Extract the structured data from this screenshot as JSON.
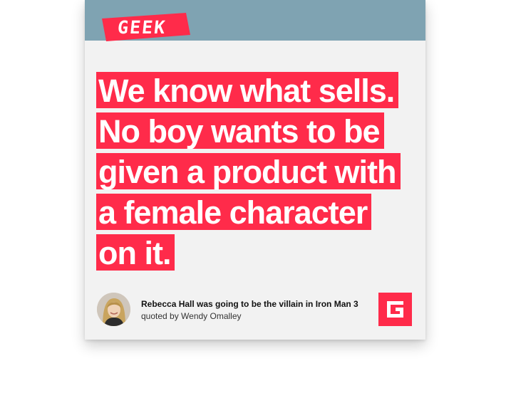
{
  "brand": {
    "logo_text": "GEEK",
    "accent_color": "#ff2b4a",
    "header_color": "#7fa3b2"
  },
  "quote": {
    "lines": [
      "We know what sells.",
      "No boy wants to be",
      "given a product with",
      "a female character",
      "on it."
    ]
  },
  "footer": {
    "avatar_icon": "author-avatar",
    "article_title": "Rebecca Hall was going to be the villain in Iron Man 3",
    "quoted_by": "quoted by Wendy Omalley",
    "badge_icon": "geek-g-logo-icon"
  }
}
